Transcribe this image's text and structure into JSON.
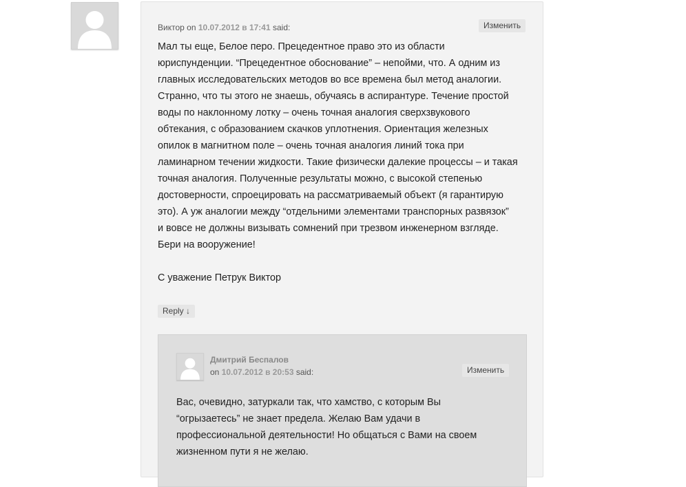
{
  "comment": {
    "author": "Виктор",
    "on": "on",
    "date": "10.07.2012 в 17:41",
    "said": "said:",
    "edit_label": "Изменить",
    "paragraph_lines": [
      "Мал ты еще, Белое перо. Прецедентное право это из области",
      "юриспунденции. “Прецедентное обоснование” – непойми, что. А одним из",
      "главных исследовательских методов во все времена был метод аналогии.",
      "Странно, что ты этого не знаешь, обучаясь в аспирантуре. Течение простой",
      "воды по наклонному лотку – очень точная аналогия сверхзвукового",
      "обтекания, с образованием скачков уплотнения. Ориентация железных",
      "опилок в магнитном поле – очень точная аналогия линий тока при",
      "ламинарном течении жидкости. Такие физически далекие процессы – и такая",
      "точная аналогия. Полученные результаты можно, с высокой степенью",
      "достоверности, спроецировать на рассматриваемый объект (я гарантирую",
      "это). А уж аналогии между “отдельними элементами транспорных развязок”",
      "и вовсе не должны визывать сомнений при трезвом инженерном взгляде.",
      "Бери на вооружение!"
    ],
    "signature": "С уважение Петрук Виктор",
    "reply_label": "Reply ↓"
  },
  "reply": {
    "author": "Дмитрий Беспалов",
    "on": "on",
    "date": "10.07.2012 в 20:53",
    "said": "said:",
    "edit_label": "Изменить",
    "text_lines": [
      "Вас, очевидно, затуркали так, что хамство, с которым Вы",
      "“огрызаетесь” не знает предела. Желаю Вам удачи в",
      "профессиональной деятельности! Но общаться с Вами на своем",
      "жизненном пути я не желаю."
    ]
  },
  "icons": {
    "avatar": "default-person-icon"
  },
  "colors": {
    "panel": "#f3f3f3",
    "nested_panel": "#dedede",
    "button": "#e6e6e6"
  }
}
